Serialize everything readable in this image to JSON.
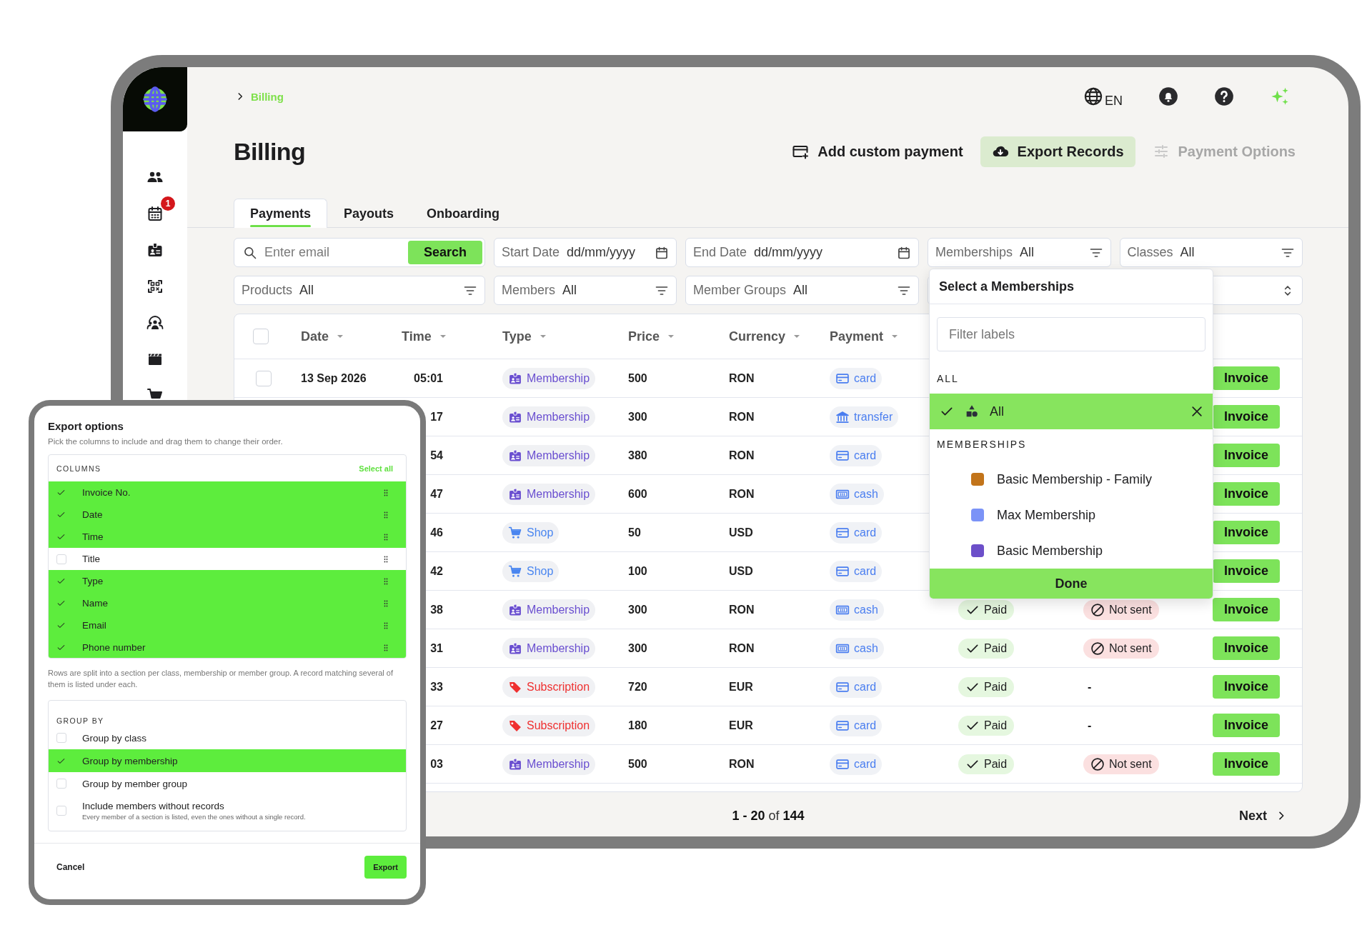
{
  "sidebar": {
    "items": [
      {
        "kind": "people"
      },
      {
        "kind": "calendar",
        "badge": "1"
      },
      {
        "kind": "idbadge"
      },
      {
        "kind": "qr"
      },
      {
        "kind": "group"
      },
      {
        "kind": "clapper"
      },
      {
        "kind": "cart"
      }
    ]
  },
  "breadcrumb": "Billing",
  "language": "EN",
  "title": "Billing",
  "actions": [
    {
      "kind": "add",
      "label": "Add custom payment",
      "disabled": false
    },
    {
      "kind": "export",
      "label": "Export Records",
      "disabled": false
    },
    {
      "kind": "options",
      "label": "Payment Options",
      "disabled": true
    }
  ],
  "tabs": [
    {
      "label": "Payments",
      "selected": true
    },
    {
      "label": "Payouts",
      "selected": false
    },
    {
      "label": "Onboarding",
      "selected": false
    }
  ],
  "filters_row_1": [
    {
      "kind": "search",
      "placeholder": "Enter email",
      "button": "Search"
    },
    {
      "kind": "date",
      "label": "Start Date",
      "placeholder": "dd/mm/yyyy"
    },
    {
      "kind": "date",
      "label": "End Date",
      "placeholder": "dd/mm/yyyy"
    },
    {
      "kind": "select",
      "label": "Memberships",
      "value": "All"
    },
    {
      "kind": "select",
      "label": "Classes",
      "value": "All"
    }
  ],
  "filters_row_2": [
    {
      "kind": "select",
      "label": "Products",
      "value": "All"
    },
    {
      "kind": "select",
      "label": "Members",
      "value": "All"
    },
    {
      "kind": "select",
      "label": "Member Groups",
      "value": "All"
    },
    {
      "kind": "stepper"
    }
  ],
  "table": {
    "all_checked": false,
    "columns": [
      "Date",
      "Time",
      "Type",
      "Price",
      "Currency",
      "Payment"
    ],
    "rows": [
      {
        "checked": false,
        "date": "13 Sep 2026",
        "time": "05:01",
        "type": {
          "kind": "membership",
          "label": "Membership"
        },
        "price": "500",
        "currency": "RON",
        "payment": {
          "kind": "card",
          "label": "card"
        },
        "action": "Invoice"
      },
      {
        "time": "17",
        "type": {
          "kind": "membership",
          "label": "Membership"
        },
        "price": "300",
        "currency": "RON",
        "payment": {
          "kind": "transfer",
          "label": "transfer"
        },
        "action": "Invoice"
      },
      {
        "time": "54",
        "type": {
          "kind": "membership",
          "label": "Membership"
        },
        "price": "380",
        "currency": "RON",
        "payment": {
          "kind": "card",
          "label": "card"
        },
        "action": "Invoice"
      },
      {
        "time": "47",
        "type": {
          "kind": "membership",
          "label": "Membership"
        },
        "price": "600",
        "currency": "RON",
        "payment": {
          "kind": "cash",
          "label": "cash"
        },
        "action": "Invoice"
      },
      {
        "time": "46",
        "type": {
          "kind": "shop",
          "label": "Shop"
        },
        "price": "50",
        "currency": "USD",
        "payment": {
          "kind": "card",
          "label": "card"
        },
        "action": "Invoice"
      },
      {
        "time": "42",
        "type": {
          "kind": "shop",
          "label": "Shop"
        },
        "price": "100",
        "currency": "USD",
        "payment": {
          "kind": "card",
          "label": "card"
        },
        "action": "Invoice"
      },
      {
        "time": "38",
        "type": {
          "kind": "membership",
          "label": "Membership"
        },
        "price": "300",
        "currency": "RON",
        "payment": {
          "kind": "cash",
          "label": "cash"
        },
        "status": "Paid",
        "invoice_status": {
          "kind": "not_sent",
          "label": "Not sent"
        },
        "action": "Invoice"
      },
      {
        "time": "31",
        "type": {
          "kind": "membership",
          "label": "Membership"
        },
        "price": "300",
        "currency": "RON",
        "payment": {
          "kind": "cash",
          "label": "cash"
        },
        "status": "Paid",
        "invoice_status": {
          "kind": "not_sent",
          "label": "Not sent"
        },
        "action": "Invoice"
      },
      {
        "time": "33",
        "type": {
          "kind": "subscription",
          "label": "Subscription"
        },
        "price": "720",
        "currency": "EUR",
        "payment": {
          "kind": "card",
          "label": "card"
        },
        "status": "Paid",
        "invoice_status": {
          "kind": "none",
          "label": "-"
        },
        "action": "Invoice"
      },
      {
        "time": "27",
        "type": {
          "kind": "subscription",
          "label": "Subscription"
        },
        "price": "180",
        "currency": "EUR",
        "payment": {
          "kind": "card",
          "label": "card"
        },
        "status": "Paid",
        "invoice_status": {
          "kind": "none",
          "label": "-"
        },
        "action": "Invoice"
      },
      {
        "time": "03",
        "type": {
          "kind": "membership",
          "label": "Membership"
        },
        "price": "500",
        "currency": "RON",
        "payment": {
          "kind": "card",
          "label": "card"
        },
        "status": "Paid",
        "invoice_status": {
          "kind": "not_sent",
          "label": "Not sent"
        },
        "action": "Invoice"
      }
    ]
  },
  "pagination": {
    "range": "**1 - 20** of **144**",
    "next": "Next"
  },
  "memberships_dropdown": {
    "title": "Select a Memberships",
    "filter_placeholder": "Filter labels",
    "all_heading": "ALL",
    "all_option": {
      "label": "All",
      "selected": true
    },
    "group_heading": "MEMBERSHIPS",
    "options": [
      {
        "label": "Basic Membership - Family",
        "color": "#c2741a",
        "selected": false
      },
      {
        "label": "Max Membership",
        "color": "#7b93f7",
        "selected": false
      },
      {
        "label": "Basic Membership",
        "color": "#6c4fc9",
        "selected": false
      }
    ],
    "done": "Done"
  },
  "export_dialog": {
    "title": "Export options",
    "subtitle": "Pick the columns to include and drag them to change their order.",
    "columns_heading": "COLUMNS",
    "select_all": "Select all",
    "columns": [
      {
        "label": "Invoice No.",
        "checked": true
      },
      {
        "label": "Date",
        "checked": true
      },
      {
        "label": "Time",
        "checked": true
      },
      {
        "label": "Title",
        "checked": false
      },
      {
        "label": "Type",
        "checked": true
      },
      {
        "label": "Name",
        "checked": true
      },
      {
        "label": "Email",
        "checked": true
      },
      {
        "label": "Phone number",
        "checked": true
      }
    ],
    "note": "Rows are split into a section per class, membership or member group. A record matching several of them is listed under each.",
    "group_heading": "GROUP BY",
    "group_options": [
      {
        "label": "Group by class",
        "checked": false
      },
      {
        "label": "Group by membership",
        "checked": true
      },
      {
        "label": "Group by member group",
        "checked": false
      },
      {
        "label": "Include members without records",
        "description": "Every member of a section is listed, even the ones without a single record.",
        "checked": false
      }
    ],
    "cancel": "Cancel",
    "export": "Export"
  }
}
